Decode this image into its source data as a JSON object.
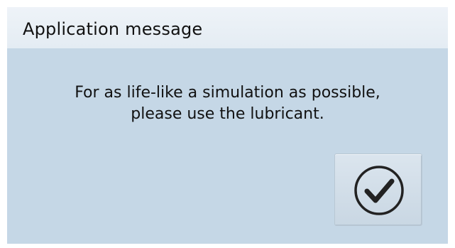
{
  "dialog": {
    "title": "Application message",
    "message_lines": [
      "For as life-like a simulation as possible,",
      "please use the lubricant."
    ],
    "confirm_icon": "checkmark-circle-icon"
  },
  "colors": {
    "dialog_background": "#c5d7e6",
    "title_bar_background": "#eef3f8",
    "text": "#111111",
    "icon": "#222222"
  }
}
